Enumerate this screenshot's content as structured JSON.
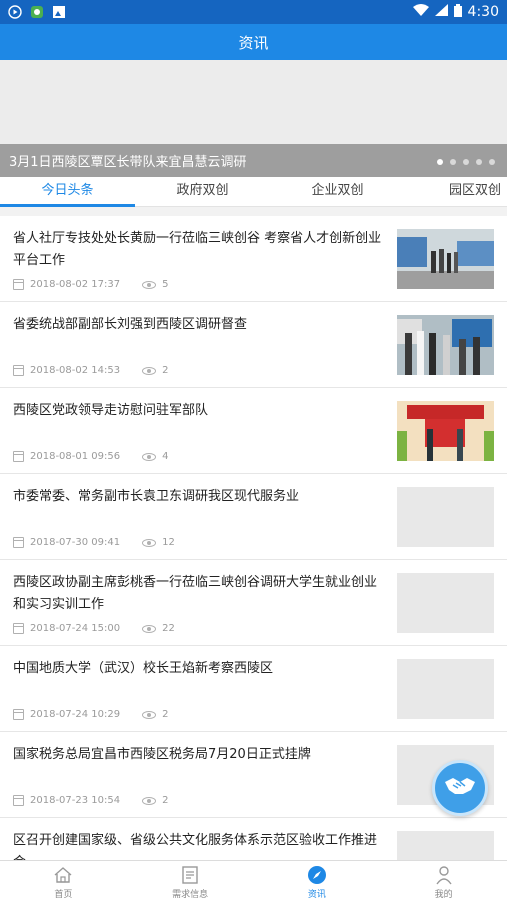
{
  "status_bar": {
    "time": "4:30"
  },
  "app_bar": {
    "title": "资讯"
  },
  "banner": {
    "caption": "3月1日西陵区覃区长带队来宜昌慧云调研",
    "dots": 5,
    "active_dot": 0
  },
  "tabs": [
    {
      "label": "今日头条",
      "active": true
    },
    {
      "label": "政府双创",
      "active": false
    },
    {
      "label": "企业双创",
      "active": false
    },
    {
      "label": "园区双创",
      "active": false
    }
  ],
  "news": [
    {
      "title": "省人社厅专技处处长黄励一行莅临三峡创谷 考察省人才创新创业平台工作",
      "date": "2018-08-02 17:37",
      "views": "5"
    },
    {
      "title": "省委统战部副部长刘强到西陵区调研督查",
      "date": "2018-08-02 14:53",
      "views": "2"
    },
    {
      "title": "西陵区党政领导走访慰问驻军部队",
      "date": "2018-08-01 09:56",
      "views": "4"
    },
    {
      "title": "市委常委、常务副市长袁卫东调研我区现代服务业",
      "date": "2018-07-30 09:41",
      "views": "12"
    },
    {
      "title": "西陵区政协副主席彭桃香一行莅临三峡创谷调研大学生就业创业和实习实训工作",
      "date": "2018-07-24 15:00",
      "views": "22"
    },
    {
      "title": "中国地质大学（武汉）校长王焰新考察西陵区",
      "date": "2018-07-24 10:29",
      "views": "2"
    },
    {
      "title": "国家税务总局宜昌市西陵区税务局7月20日正式挂牌",
      "date": "2018-07-23 10:54",
      "views": "2"
    },
    {
      "title": "区召开创建国家级、省级公共文化服务体系示范区验收工作推进会",
      "date": "",
      "views": ""
    }
  ],
  "bottom_nav": [
    {
      "label": "首页",
      "icon": "home-icon",
      "active": false
    },
    {
      "label": "需求信息",
      "icon": "list-icon",
      "active": false
    },
    {
      "label": "资讯",
      "icon": "compass-icon",
      "active": true
    },
    {
      "label": "我的",
      "icon": "person-icon",
      "active": false
    }
  ],
  "colors": {
    "primary": "#1e88e5",
    "status_bar": "#1565c0"
  }
}
